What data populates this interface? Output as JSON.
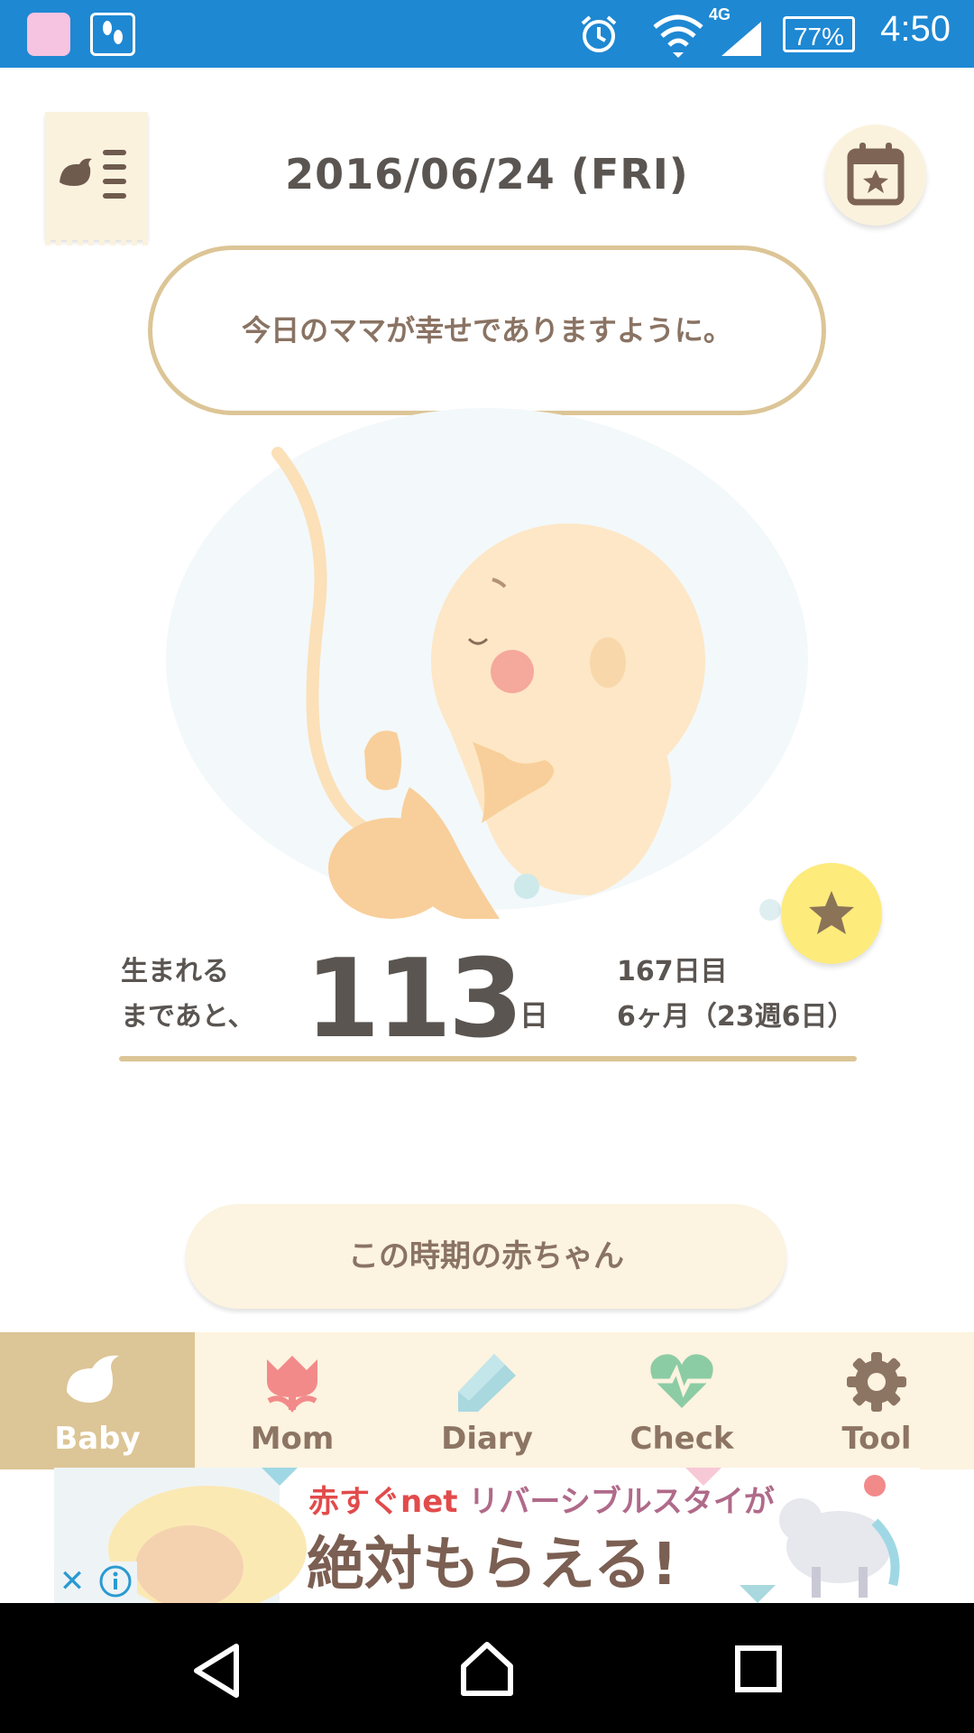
{
  "status_bar": {
    "time": "4:50",
    "battery": "77%",
    "network": "4G"
  },
  "header": {
    "date": "2016/06/24 (FRI)"
  },
  "message": {
    "text": "今日のママが幸せでありますように。"
  },
  "countdown": {
    "label_line1": "生まれる",
    "label_line2": "まであと、",
    "days_remaining": "113",
    "unit": "日",
    "day_count": "167日目",
    "month_week": "6ヶ月（23週6日）"
  },
  "info_button": {
    "label": "この時期の赤ちゃん"
  },
  "tabs": [
    {
      "label": "Baby",
      "icon": "bird-icon",
      "active": true
    },
    {
      "label": "Mom",
      "icon": "tulip-icon",
      "active": false
    },
    {
      "label": "Diary",
      "icon": "pencil-icon",
      "active": false
    },
    {
      "label": "Check",
      "icon": "heart-pulse-icon",
      "active": false
    },
    {
      "label": "Tool",
      "icon": "gear-icon",
      "active": false
    }
  ],
  "ad": {
    "brand": "赤すぐnet",
    "line1_rest": " リバーシブルスタイが",
    "line2": "絶対もらえる!"
  },
  "colors": {
    "status_bar": "#1e88d3",
    "accent_tan": "#dcc596",
    "cream": "#fcf3e0",
    "text_dark": "#5a5551",
    "star_yellow": "#fdeb7c"
  }
}
